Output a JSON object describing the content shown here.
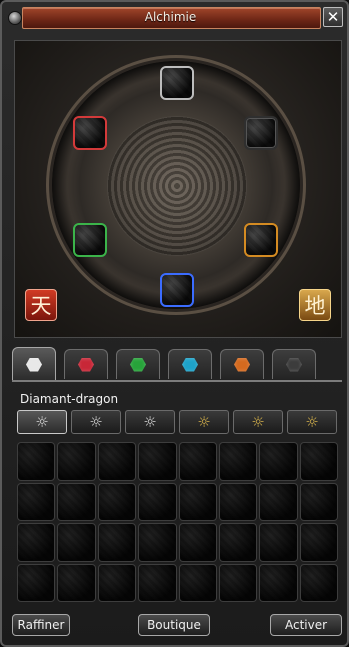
{
  "window": {
    "title": "Alchimie",
    "close_label": "✕"
  },
  "alchemy": {
    "slots": [
      {
        "name": "slot-top",
        "color": "white",
        "accent": "#bdbdbd"
      },
      {
        "name": "slot-upper-left",
        "color": "red",
        "accent": "#d33a3a"
      },
      {
        "name": "slot-upper-right",
        "color": "black",
        "accent": "#2f2f2f"
      },
      {
        "name": "slot-lower-left",
        "color": "green",
        "accent": "#3bb44a"
      },
      {
        "name": "slot-lower-right",
        "color": "orange",
        "accent": "#d48b22"
      },
      {
        "name": "slot-bottom",
        "color": "blue",
        "accent": "#3b6cff"
      }
    ],
    "left_symbol": "天",
    "right_symbol": "地"
  },
  "tabs": [
    {
      "gem": "white",
      "color": "#e8e8e8",
      "active": true
    },
    {
      "gem": "red",
      "color": "#c82737",
      "active": false
    },
    {
      "gem": "green",
      "color": "#27a33a",
      "active": false
    },
    {
      "gem": "blue",
      "color": "#1ea3c9",
      "active": false
    },
    {
      "gem": "orange",
      "color": "#d46a1f",
      "active": false
    },
    {
      "gem": "black",
      "color": "#3c3c3c",
      "active": false
    }
  ],
  "section_title": "Diamant-dragon",
  "grades": [
    {
      "icon": "sun-icon",
      "glyph": "☼",
      "active": true
    },
    {
      "icon": "sun-icon",
      "glyph": "☼",
      "active": false
    },
    {
      "icon": "sun-icon",
      "glyph": "☼",
      "active": false
    },
    {
      "icon": "sun-icon",
      "glyph": "☼",
      "active": false
    },
    {
      "icon": "sun-icon",
      "glyph": "☼",
      "active": false
    },
    {
      "icon": "sun-icon",
      "glyph": "☼",
      "active": false
    }
  ],
  "inventory": {
    "rows": 4,
    "cols": 8
  },
  "buttons": {
    "refine": "Raffiner",
    "shop": "Boutique",
    "activate": "Activer"
  }
}
